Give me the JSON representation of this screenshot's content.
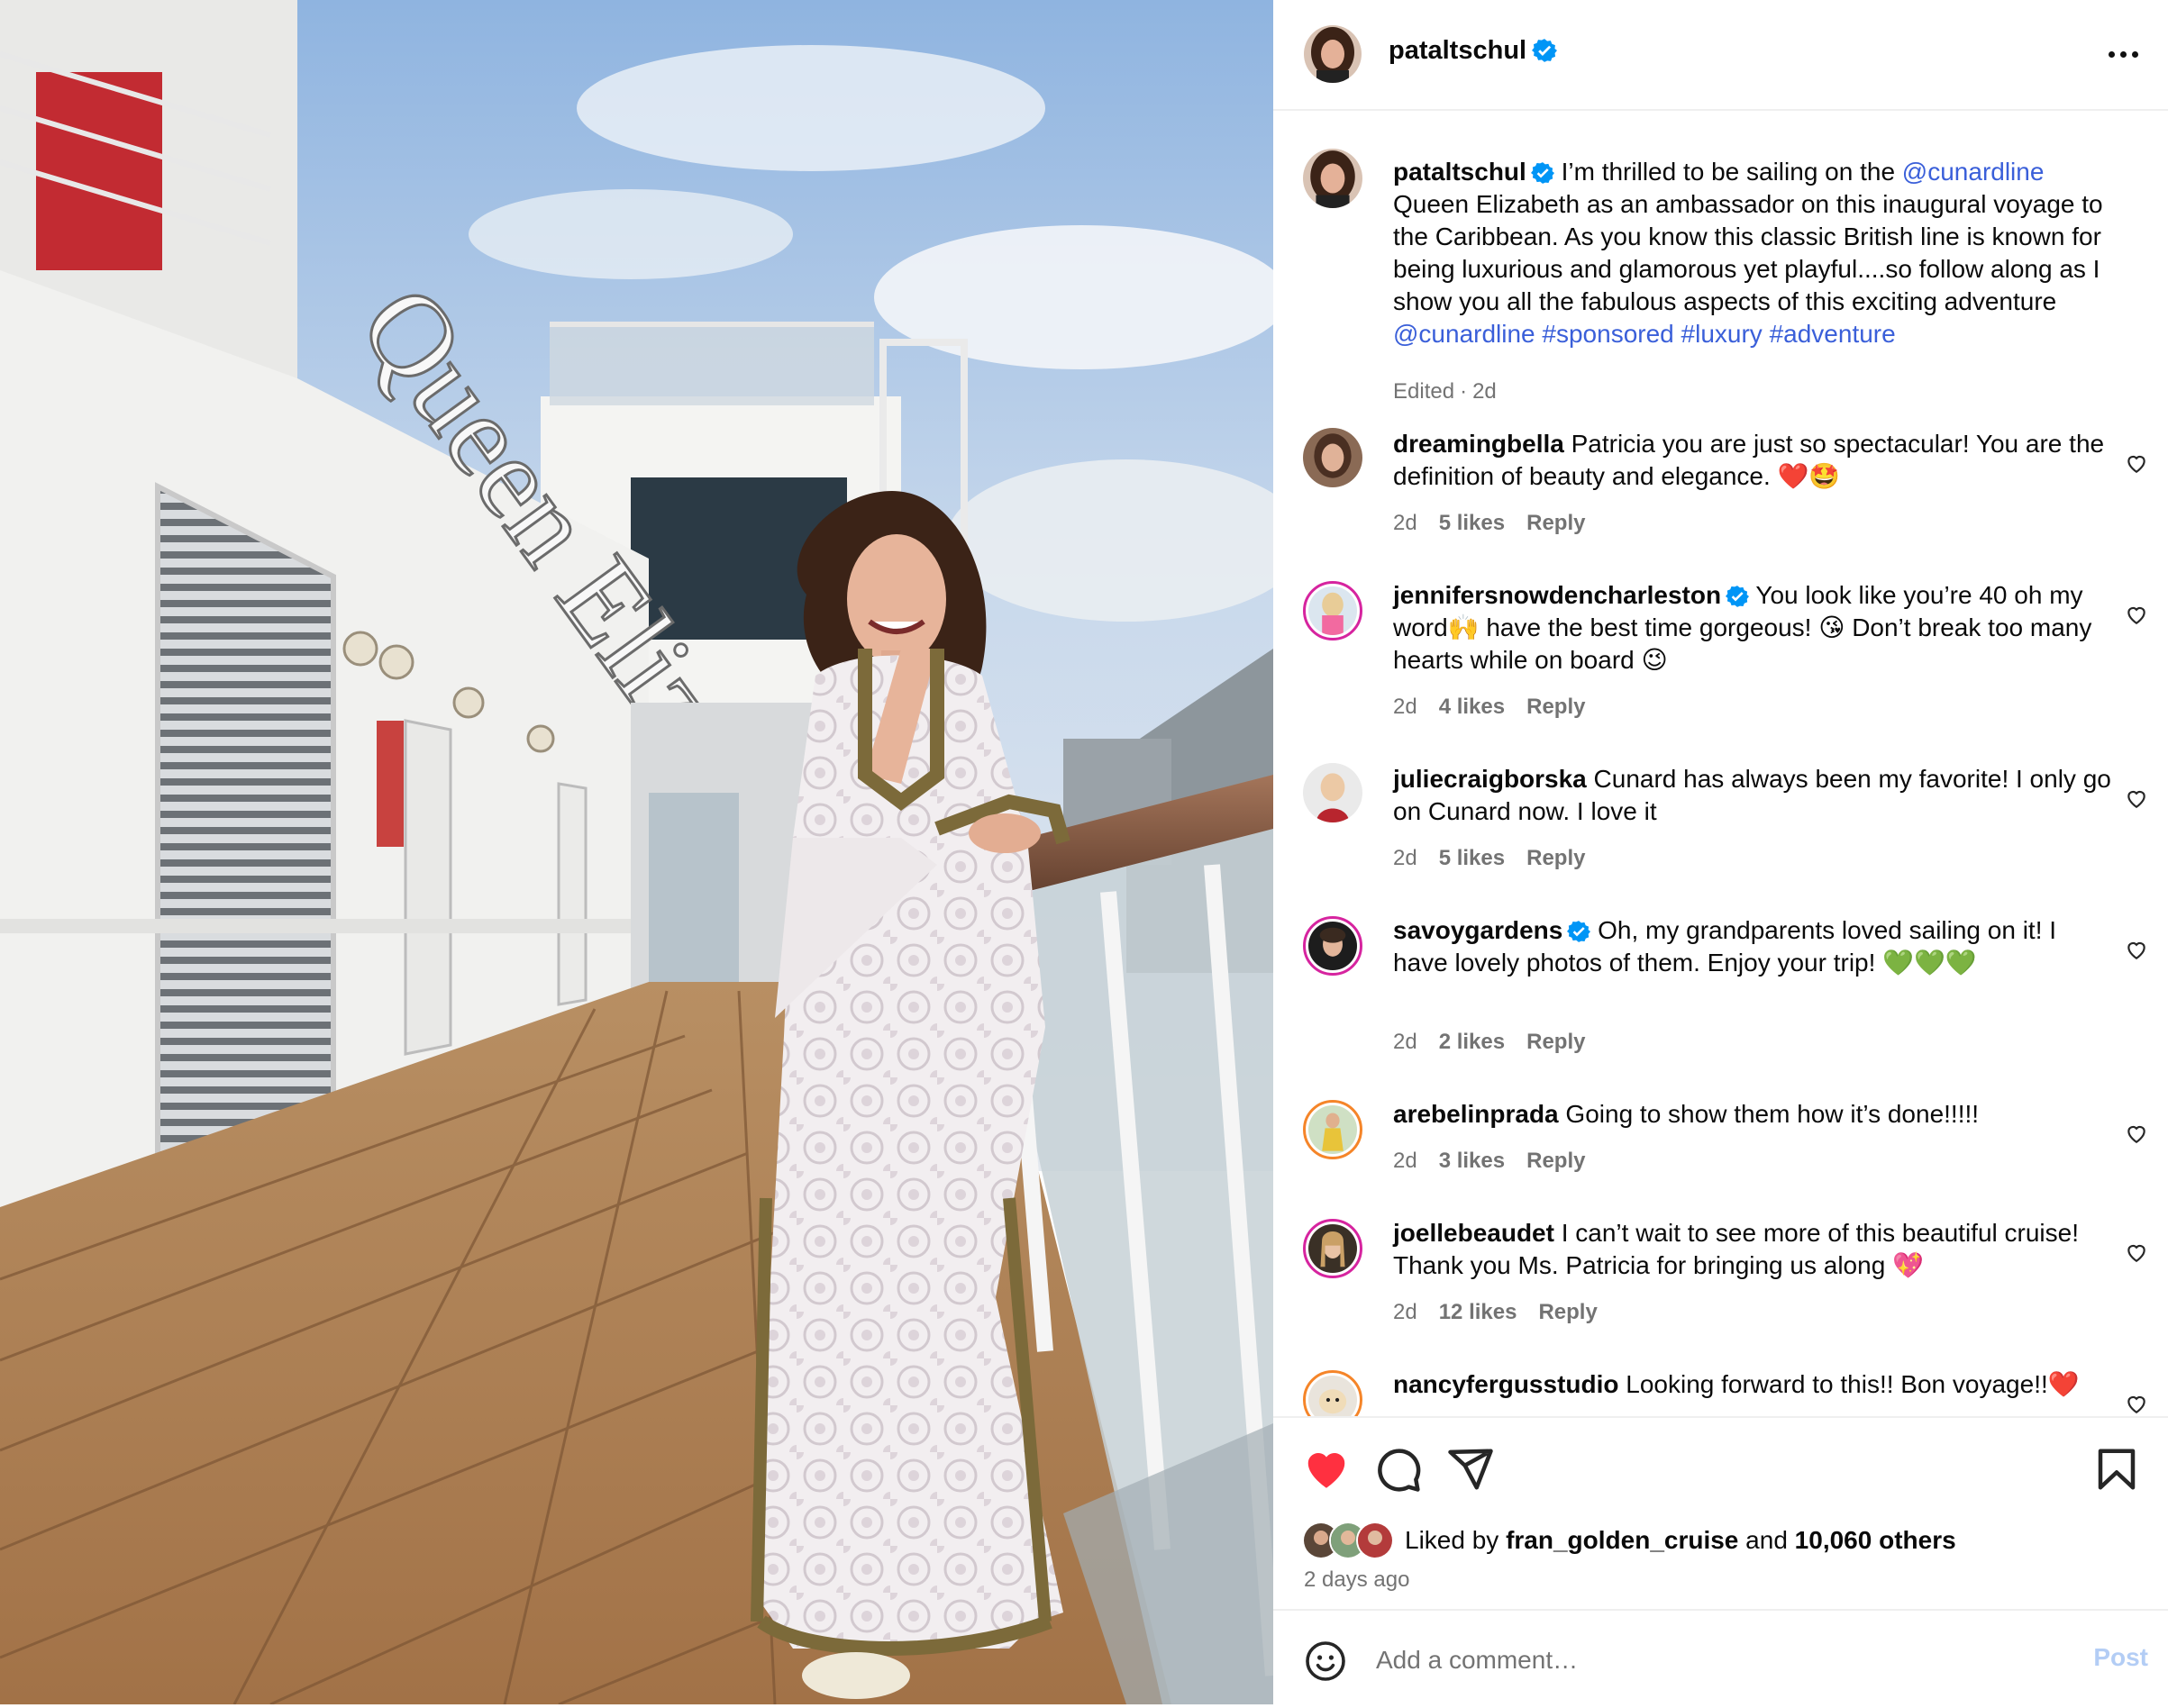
{
  "post": {
    "author": "pataltschul",
    "verified": true,
    "more_icon": "more-horizontal-icon",
    "photo_description_icon": "photo",
    "ship_lettering": "Queen Elizabeth",
    "caption": {
      "username": "pataltschul",
      "part1": " I’m thrilled to be sailing on the ",
      "mention1": "@cunardline",
      "part2": " Queen Elizabeth as an ambassador on this inaugural voyage to the Caribbean. As you know this classic British line is known for being luxurious and glamorous yet playful....so follow along as I show you all the fabulous aspects of this exciting adventure ",
      "mention2": "@cunardline",
      "tags": [
        "#sponsored",
        "#luxury",
        "#adventure"
      ],
      "edited": "Edited",
      "separator": "·",
      "time": "2d"
    }
  },
  "comments": [
    {
      "username": "dreamingbella",
      "verified": false,
      "text": " Patricia you are just so spectacular! You are the definition of beauty and elegance. ❤️🤩",
      "time": "2d",
      "likes": "5 likes",
      "reply": "Reply"
    },
    {
      "username": "jennifersnowdencharleston",
      "verified": true,
      "text": " You look like you’re 40 oh my word🙌 have the best time gorgeous! 😘 Don’t break too many hearts while on board 😉",
      "time": "2d",
      "likes": "4 likes",
      "reply": "Reply"
    },
    {
      "username": "juliecraigborska",
      "verified": false,
      "text": " Cunard has always been my favorite! I only go on Cunard now. I love it",
      "time": "2d",
      "likes": "5 likes",
      "reply": "Reply"
    },
    {
      "username": "savoygardens",
      "verified": true,
      "text": " Oh, my grandparents loved sailing on it! I have lovely photos of them. Enjoy your trip! 💚💚💚",
      "time": "2d",
      "likes": "2 likes",
      "reply": "Reply"
    },
    {
      "username": "arebelinprada",
      "verified": false,
      "text": " Going to show them how it’s done!!!!!",
      "time": "2d",
      "likes": "3 likes",
      "reply": "Reply"
    },
    {
      "username": "joellebeaudet",
      "verified": false,
      "text": " I can’t wait to see more of this beautiful cruise! Thank you Ms. Patricia for bringing us along 💖",
      "time": "2d",
      "likes": "12 likes",
      "reply": "Reply"
    },
    {
      "username": "nancyfergusstudio",
      "verified": false,
      "text": " Looking forward to this!! Bon voyage!!❤️",
      "time": "",
      "likes": "",
      "reply": ""
    }
  ],
  "actions": {
    "like_icon": "heart-filled-icon",
    "comment_icon": "comment-icon",
    "share_icon": "send-icon",
    "save_icon": "bookmark-icon",
    "like_color": "#ff3040",
    "liked_prefix": "Liked by ",
    "liked_user": "fran_golden_cruise",
    "liked_and": " and ",
    "liked_others": "10,060 others",
    "posted_ago": "2 days ago"
  },
  "composer": {
    "placeholder": "Add a comment…",
    "post_label": "Post",
    "emoji_icon": "emoji-icon"
  },
  "colors": {
    "link": "#3a5fd9",
    "verified": "#0095f6",
    "muted": "#737373",
    "post_disabled": "#b3cdf5"
  }
}
